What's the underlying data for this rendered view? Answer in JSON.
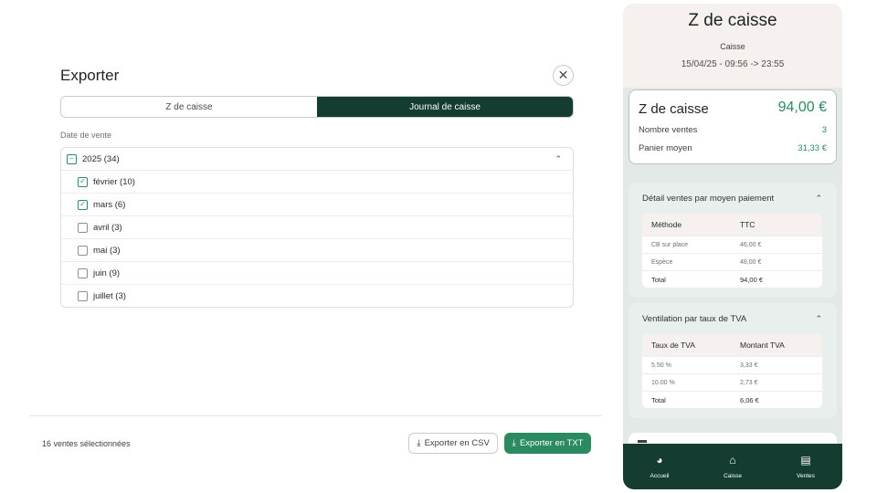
{
  "modal": {
    "title": "Exporter",
    "close_label": "✕",
    "tabs": [
      {
        "label": "Z de caisse",
        "active": false
      },
      {
        "label": "Journal de caisse",
        "active": true
      }
    ],
    "section_label": "Date de vente",
    "year": {
      "label": "2025 (34)",
      "state": "partial",
      "expanded": true
    },
    "months": [
      {
        "label": "février (10)",
        "checked": true
      },
      {
        "label": "mars (6)",
        "checked": true
      },
      {
        "label": "avril (3)",
        "checked": false
      },
      {
        "label": "mai (3)",
        "checked": false
      },
      {
        "label": "juin (9)",
        "checked": false
      },
      {
        "label": "juillet (3)",
        "checked": false
      }
    ],
    "selected_count": "16 ventes sélectionnées",
    "export_csv": "Exporter en CSV",
    "export_txt": "Exporter en TXT"
  },
  "receipt": {
    "title": "Z de caisse",
    "subtitle": "Caisse",
    "date_range": "15/04/25 - 09:56 -> 23:55",
    "summary": {
      "title": "Z de caisse",
      "amount": "94,00 €",
      "rows": [
        {
          "label": "Nombre ventes",
          "value": "3"
        },
        {
          "label": "Panier moyen",
          "value": "31,33 €"
        }
      ]
    },
    "payment": {
      "title": "Détail ventes par moyen paiement",
      "headers": [
        "Méthode",
        "TTC"
      ],
      "rows": [
        [
          "CB sur place",
          "46,00 €"
        ],
        [
          "Espèce",
          "48,00 €"
        ]
      ],
      "total": [
        "Total",
        "94,00 €"
      ]
    },
    "vat": {
      "title": "Ventilation par taux de TVA",
      "headers": [
        "Taux de TVA",
        "Montant TVA"
      ],
      "rows": [
        [
          "5.50 %",
          "3,33 €"
        ],
        [
          "10.00 %",
          "2,73 €"
        ]
      ],
      "total": [
        "Total",
        "6,06 €"
      ]
    },
    "nav": [
      {
        "label": "Accueil",
        "icon": "pie-chart-icon"
      },
      {
        "label": "Caisse",
        "icon": "basket-icon"
      },
      {
        "label": "Ventes",
        "icon": "receipt-icon"
      }
    ]
  },
  "colors": {
    "accent_dark": "#143c31",
    "accent_green": "#2b8a5f",
    "panel_bg": "#e2e9e6"
  }
}
